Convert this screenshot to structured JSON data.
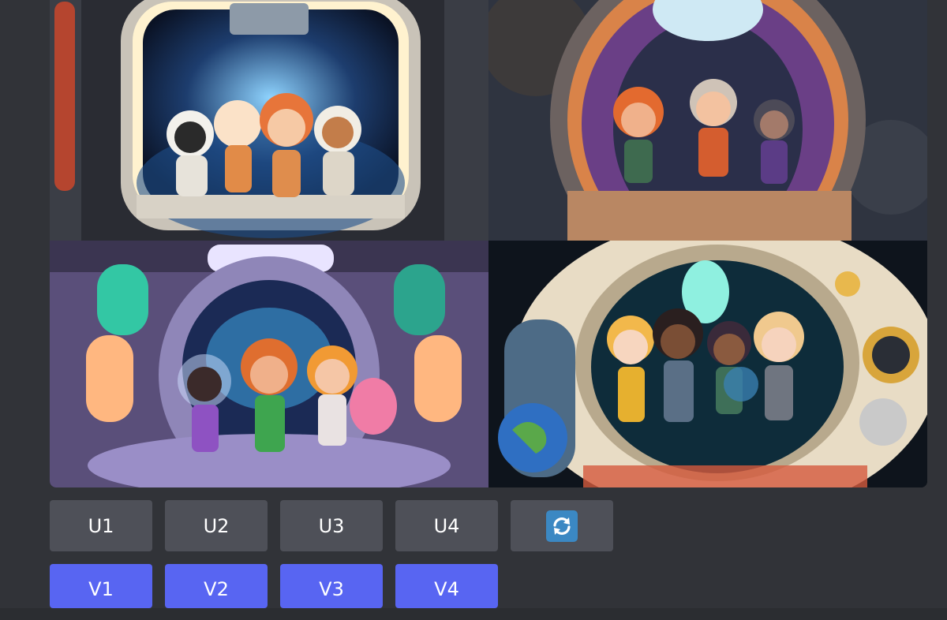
{
  "image": {
    "alt": "",
    "tiles": [
      {
        "scene": "spaceship-porthole-four-astronaut-kids"
      },
      {
        "scene": "spaceship-hatch-three-kids-purple"
      },
      {
        "scene": "spaceship-corridor-three-kids-dancing"
      },
      {
        "scene": "round-porthole-four-kids-earth"
      }
    ]
  },
  "upscale_buttons": [
    {
      "label": "U1"
    },
    {
      "label": "U2"
    },
    {
      "label": "U3"
    },
    {
      "label": "U4"
    }
  ],
  "reroll_button": {
    "icon": "reroll-icon"
  },
  "variation_buttons": [
    {
      "label": "V1"
    },
    {
      "label": "V2"
    },
    {
      "label": "V3"
    },
    {
      "label": "V4"
    }
  ],
  "colors": {
    "background": "#313338",
    "secondary_button": "#4e5058",
    "primary_button": "#5865f2",
    "reroll_icon_bg": "#3b88c3"
  }
}
